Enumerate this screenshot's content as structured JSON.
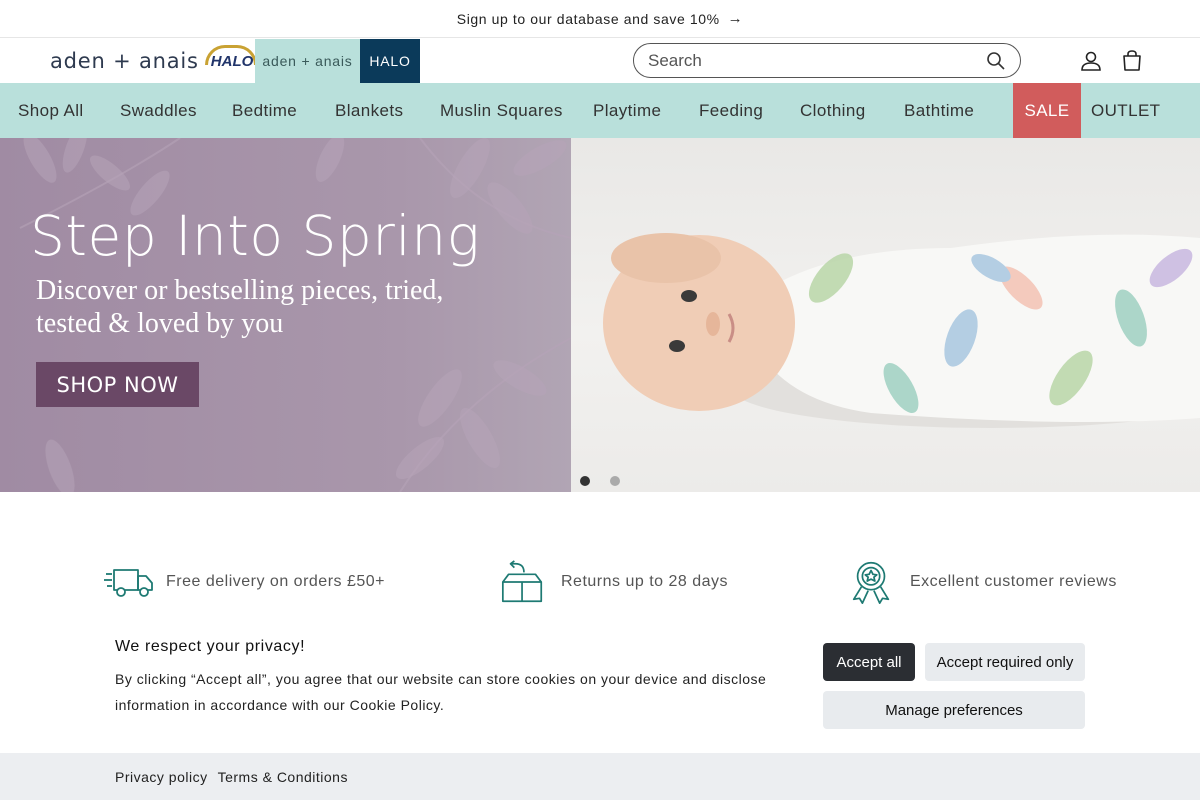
{
  "announcement": {
    "text": "Sign up to our database and save 10%",
    "arrow": "→"
  },
  "header": {
    "logo_text": "aden + anais",
    "logo_halo": "HALO",
    "brand_tabs": [
      {
        "label": "aden + anais",
        "active": true
      },
      {
        "label": "HALO",
        "active": false
      }
    ],
    "search": {
      "placeholder": "Search"
    },
    "icons": [
      "search-icon",
      "account-icon",
      "cart-icon"
    ]
  },
  "nav": {
    "items": [
      {
        "label": "Shop All"
      },
      {
        "label": "Swaddles"
      },
      {
        "label": "Bedtime"
      },
      {
        "label": "Blankets"
      },
      {
        "label": "Muslin Squares"
      },
      {
        "label": "Playtime"
      },
      {
        "label": "Feeding"
      },
      {
        "label": "Clothing"
      },
      {
        "label": "Bathtime"
      },
      {
        "label": "SALE",
        "highlight": "#d15c5c"
      },
      {
        "label": "OUTLET"
      }
    ]
  },
  "hero": {
    "title": "Step Into Spring",
    "subtitle": "Discover or bestselling pieces, tried, tested & loved by you",
    "cta": "SHOP NOW",
    "slides": 2,
    "active_slide": 1
  },
  "features": [
    {
      "icon": "delivery-truck-icon",
      "text": "Free delivery on orders £50+"
    },
    {
      "icon": "returns-box-icon",
      "text": "Returns up to 28 days"
    },
    {
      "icon": "award-badge-icon",
      "text": "Excellent customer reviews"
    }
  ],
  "cookie": {
    "title": "We respect your privacy!",
    "text": "By clicking “Accept all”, you agree that our website can store cookies on your device and disclose information in accordance with our Cookie Policy.",
    "buttons": {
      "accept_all": "Accept all",
      "accept_required": "Accept required only",
      "manage": "Manage preferences"
    }
  },
  "footer": {
    "links": [
      "Privacy policy",
      "Terms & Conditions"
    ]
  },
  "colors": {
    "nav_bg": "#b9e0db",
    "sale": "#d15c5c",
    "halo_tab": "#0b3a5a",
    "hero_left": "#a997ab",
    "cta": "#6a4866",
    "accept_btn": "#2b2e33",
    "icon_teal": "#1e7a73"
  }
}
